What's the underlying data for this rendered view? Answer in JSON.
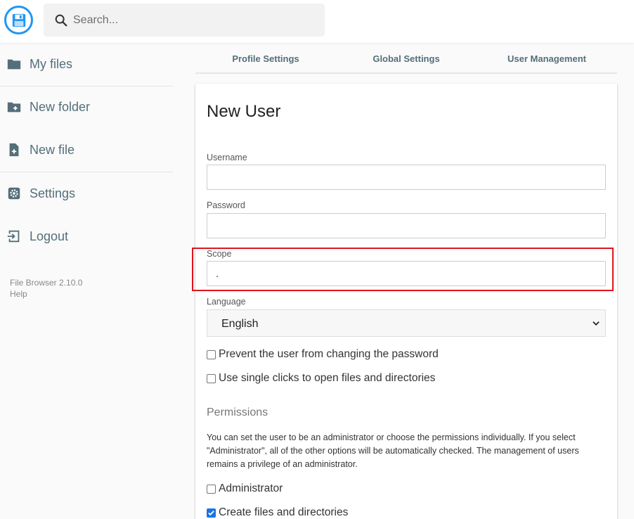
{
  "header": {
    "logo_icon": "floppy-disk-icon",
    "search": {
      "placeholder": "Search...",
      "icon": "search-icon"
    }
  },
  "sidebar": {
    "items": [
      {
        "label": "My files",
        "icon": "folder-icon"
      },
      {
        "label": "New folder",
        "icon": "folder-plus-icon"
      },
      {
        "label": "New file",
        "icon": "file-plus-icon"
      },
      {
        "label": "Settings",
        "icon": "gear-icon"
      },
      {
        "label": "Logout",
        "icon": "logout-icon"
      }
    ],
    "version": "File Browser 2.10.0",
    "help": "Help"
  },
  "tabs": [
    "Profile Settings",
    "Global Settings",
    "User Management"
  ],
  "form": {
    "title": "New User",
    "username": {
      "label": "Username",
      "value": ""
    },
    "password": {
      "label": "Password",
      "value": ""
    },
    "scope": {
      "label": "Scope",
      "value": "."
    },
    "language": {
      "label": "Language",
      "value": "English"
    },
    "checkboxes": [
      {
        "label": "Prevent the user from changing the password",
        "checked": false
      },
      {
        "label": "Use single clicks to open files and directories",
        "checked": false
      }
    ],
    "permissions": {
      "title": "Permissions",
      "description": "You can set the user to be an administrator or choose the permissions individually. If you select \"Administrator\", all of the other options will be automatically checked. The management of users remains a privilege of an administrator.",
      "options": [
        {
          "label": "Administrator",
          "checked": false
        },
        {
          "label": "Create files and directories",
          "checked": true
        }
      ]
    }
  },
  "colors": {
    "accent": "#2196f3",
    "highlight": "#e0141b",
    "sidebar_text": "#546e7a"
  }
}
